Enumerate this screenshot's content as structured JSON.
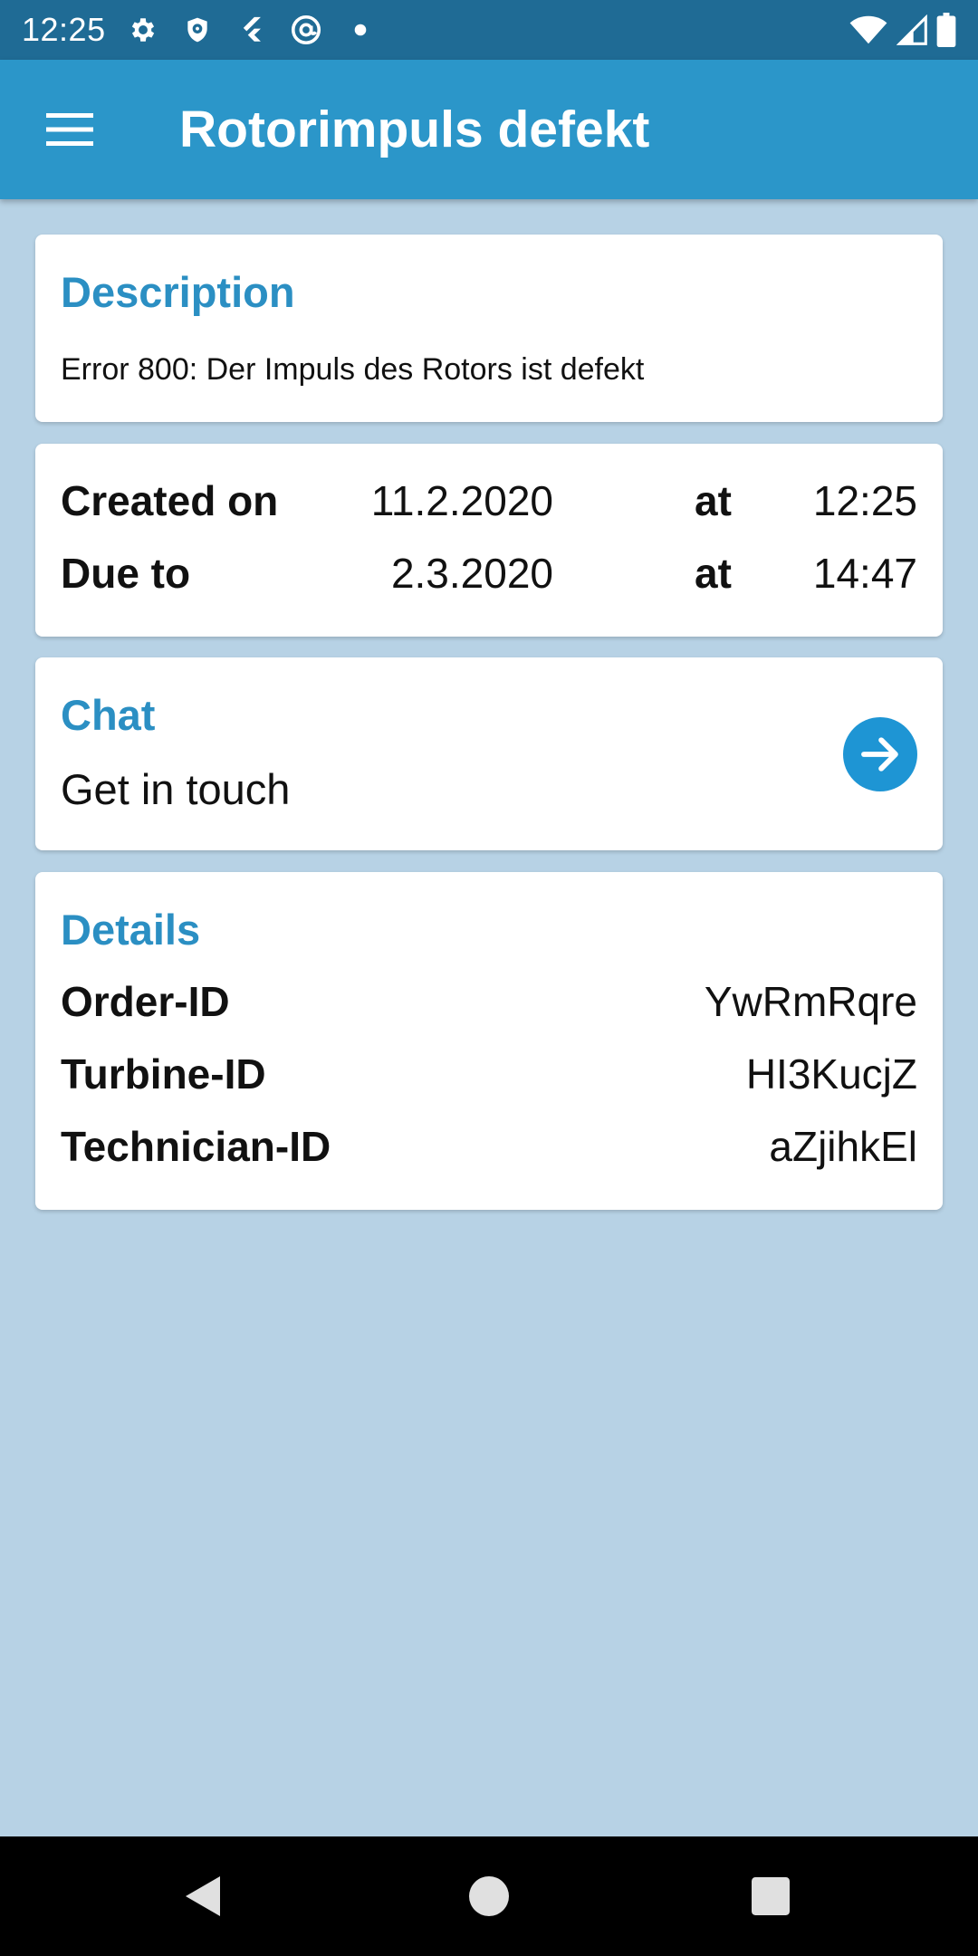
{
  "status_bar": {
    "time": "12:25",
    "icons_left": [
      "gear-icon",
      "shield-icon",
      "flutter-icon",
      "at-sign-icon",
      "dot-icon"
    ],
    "icons_right": [
      "wifi-icon",
      "signal-icon",
      "battery-icon"
    ]
  },
  "app_bar": {
    "menu_icon": "hamburger-menu-icon",
    "title": "Rotorimpuls defekt",
    "color": "#2b96c9"
  },
  "description": {
    "heading": "Description",
    "text": "Error 800: Der Impuls des Rotors ist defekt"
  },
  "dates": {
    "created": {
      "label": "Created on",
      "date": "11.2.2020",
      "at": "at",
      "time": "12:25"
    },
    "due": {
      "label": "Due to",
      "date": "2.3.2020",
      "at": "at",
      "time": "14:47"
    }
  },
  "chat": {
    "heading": "Chat",
    "subtitle": "Get in touch",
    "action_icon": "arrow-right-icon",
    "accent": "#1e95d4"
  },
  "details": {
    "heading": "Details",
    "rows": [
      {
        "label": "Order-ID",
        "value": "YwRmRqre"
      },
      {
        "label": "Turbine-ID",
        "value": "HI3KucjZ"
      },
      {
        "label": "Technician-ID",
        "value": "aZjihkEl"
      }
    ]
  },
  "nav_bar": {
    "buttons": [
      "back-icon",
      "home-icon",
      "recents-icon"
    ]
  },
  "colors": {
    "background": "#b7d2e5",
    "heading": "#2b8fc3",
    "status_bar": "#1f6b95"
  }
}
